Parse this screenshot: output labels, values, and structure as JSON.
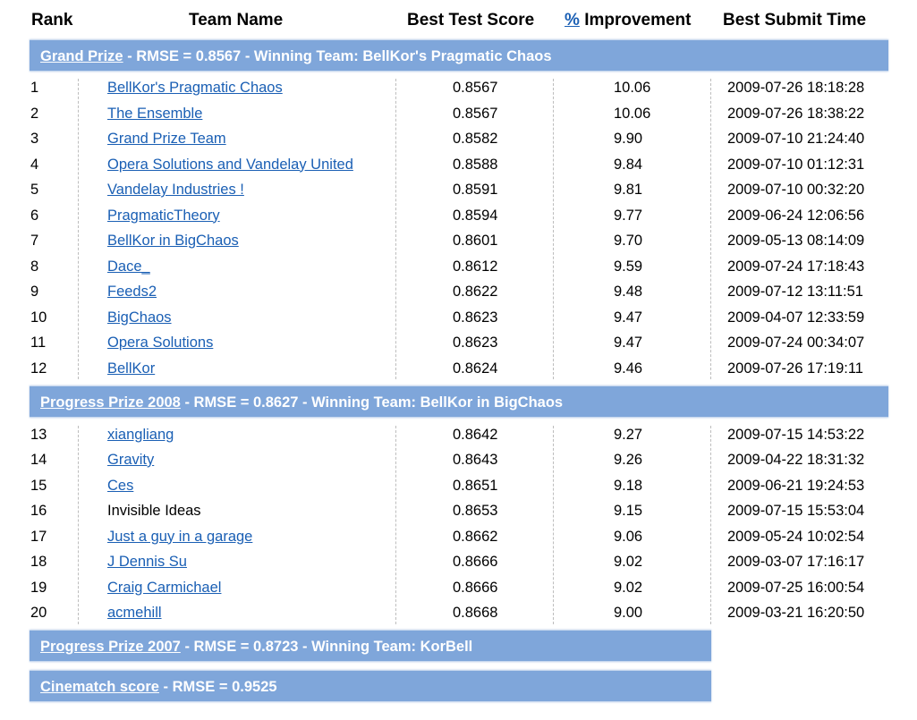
{
  "header": {
    "rank": "Rank",
    "team_name": "Team Name",
    "best_test_score": "Best Test Score",
    "pct_link": "%",
    "improvement": "Improvement",
    "best_submit_time": "Best Submit Time"
  },
  "prizes": [
    {
      "link": "Grand Prize",
      "rest": " - RMSE = 0.8567 - Winning Team: BellKor's Pragmatic Chaos"
    },
    {
      "link": "Progress Prize 2008",
      "rest": " - RMSE = 0.8627 - Winning Team: BellKor in BigChaos"
    },
    {
      "link": "Progress Prize 2007",
      "rest": " - RMSE = 0.8723 - Winning Team: KorBell"
    },
    {
      "link": "Cinematch score",
      "rest": " - RMSE = 0.9525"
    }
  ],
  "rows": [
    {
      "rank": "1",
      "team": "BellKor's Pragmatic Chaos",
      "linked": true,
      "score": "0.8567",
      "improvement": "10.06",
      "time": "2009-07-26 18:18:28"
    },
    {
      "rank": "2",
      "team": "The Ensemble",
      "linked": true,
      "score": "0.8567",
      "improvement": "10.06",
      "time": "2009-07-26 18:38:22"
    },
    {
      "rank": "3",
      "team": "Grand Prize Team",
      "linked": true,
      "score": "0.8582",
      "improvement": "9.90",
      "time": "2009-07-10 21:24:40"
    },
    {
      "rank": "4",
      "team": "Opera Solutions and Vandelay United",
      "linked": true,
      "score": "0.8588",
      "improvement": "9.84",
      "time": "2009-07-10 01:12:31"
    },
    {
      "rank": "5",
      "team": "Vandelay Industries !",
      "linked": true,
      "score": "0.8591",
      "improvement": "9.81",
      "time": "2009-07-10 00:32:20"
    },
    {
      "rank": "6",
      "team": "PragmaticTheory",
      "linked": true,
      "score": "0.8594",
      "improvement": "9.77",
      "time": "2009-06-24 12:06:56"
    },
    {
      "rank": "7",
      "team": "BellKor in BigChaos",
      "linked": true,
      "score": "0.8601",
      "improvement": "9.70",
      "time": "2009-05-13 08:14:09"
    },
    {
      "rank": "8",
      "team": "Dace_",
      "linked": true,
      "score": "0.8612",
      "improvement": "9.59",
      "time": "2009-07-24 17:18:43"
    },
    {
      "rank": "9",
      "team": "Feeds2",
      "linked": true,
      "score": "0.8622",
      "improvement": "9.48",
      "time": "2009-07-12 13:11:51"
    },
    {
      "rank": "10",
      "team": "BigChaos",
      "linked": true,
      "score": "0.8623",
      "improvement": "9.47",
      "time": "2009-04-07 12:33:59"
    },
    {
      "rank": "11",
      "team": "Opera Solutions",
      "linked": true,
      "score": "0.8623",
      "improvement": "9.47",
      "time": "2009-07-24 00:34:07"
    },
    {
      "rank": "12",
      "team": "BellKor",
      "linked": true,
      "score": "0.8624",
      "improvement": "9.46",
      "time": "2009-07-26 17:19:11"
    },
    {
      "rank": "13",
      "team": "xiangliang",
      "linked": true,
      "score": "0.8642",
      "improvement": "9.27",
      "time": "2009-07-15 14:53:22"
    },
    {
      "rank": "14",
      "team": "Gravity",
      "linked": true,
      "score": "0.8643",
      "improvement": "9.26",
      "time": "2009-04-22 18:31:32"
    },
    {
      "rank": "15",
      "team": "Ces",
      "linked": true,
      "score": "0.8651",
      "improvement": "9.18",
      "time": "2009-06-21 19:24:53"
    },
    {
      "rank": "16",
      "team": "Invisible Ideas",
      "linked": false,
      "score": "0.8653",
      "improvement": "9.15",
      "time": "2009-07-15 15:53:04"
    },
    {
      "rank": "17",
      "team": "Just a guy in a garage",
      "linked": true,
      "score": "0.8662",
      "improvement": "9.06",
      "time": "2009-05-24 10:02:54"
    },
    {
      "rank": "18",
      "team": "J Dennis Su",
      "linked": true,
      "score": "0.8666",
      "improvement": "9.02",
      "time": "2009-03-07 17:16:17"
    },
    {
      "rank": "19",
      "team": "Craig Carmichael",
      "linked": true,
      "score": "0.8666",
      "improvement": "9.02",
      "time": "2009-07-25 16:00:54"
    },
    {
      "rank": "20",
      "team": "acmehill",
      "linked": true,
      "score": "0.8668",
      "improvement": "9.00",
      "time": "2009-03-21 16:20:50"
    }
  ]
}
